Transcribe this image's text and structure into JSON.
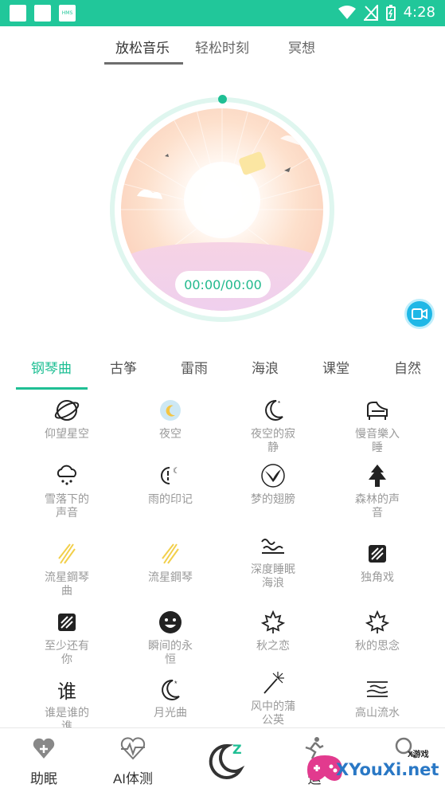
{
  "status_bar": {
    "time": "4:28",
    "hms_label": "HMS"
  },
  "top_tabs": {
    "items": [
      "放松音乐",
      "轻松时刻",
      "冥想"
    ],
    "active": 0
  },
  "player": {
    "time": "00:00/00:00"
  },
  "categories": {
    "items": [
      "钢琴曲",
      "古筝",
      "雷雨",
      "海浪",
      "课堂",
      "自然"
    ],
    "active": 0
  },
  "tracks": [
    {
      "label": "仰望星空",
      "icon": "planet-icon"
    },
    {
      "label": "夜空",
      "icon": "night-sky-icon"
    },
    {
      "label": "夜空的寂静",
      "icon": "moon-stars-icon"
    },
    {
      "label": "慢音樂入睡",
      "icon": "piano-icon"
    },
    {
      "label": "雪落下的声音",
      "icon": "snow-cloud-icon"
    },
    {
      "label": "雨的印记",
      "icon": "rain-moon-icon"
    },
    {
      "label": "梦的翅膀",
      "icon": "bird-icon"
    },
    {
      "label": "森林的声音",
      "icon": "tree-icon"
    },
    {
      "label": "流星鋼琴曲",
      "icon": "meteor-icon"
    },
    {
      "label": "流星鋼琴",
      "icon": "meteor-icon"
    },
    {
      "label": "深度睡眠海浪",
      "icon": "wave-icon"
    },
    {
      "label": "独角戏",
      "icon": "striped-square-icon"
    },
    {
      "label": "至少还有你",
      "icon": "striped-square-icon"
    },
    {
      "label": "瞬间的永恒",
      "icon": "smiley-icon"
    },
    {
      "label": "秋之恋",
      "icon": "maple-leaf-icon"
    },
    {
      "label": "秋的思念",
      "icon": "maple-leaf-icon"
    },
    {
      "label": "谁是谁的谁",
      "icon": "character-icon"
    },
    {
      "label": "月光曲",
      "icon": "crescent-moon-icon"
    },
    {
      "label": "风中的蒲公英",
      "icon": "dandelion-icon"
    },
    {
      "label": "高山流水",
      "icon": "mountain-water-icon"
    }
  ],
  "bottom_nav": {
    "items": [
      "助眠",
      "AI体测",
      "",
      "运"
    ]
  },
  "watermark": {
    "text": "XYouXi.net",
    "sub": "X游戏"
  },
  "colors": {
    "accent": "#1fbf94",
    "status_bar": "#21c79a",
    "video": "#1eb7e6"
  }
}
